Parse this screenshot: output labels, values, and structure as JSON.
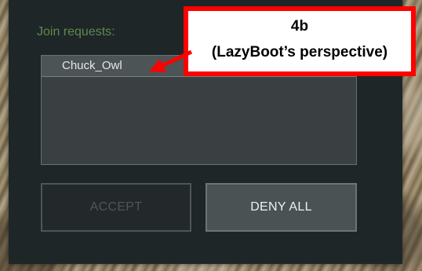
{
  "dialog": {
    "join_requests_label": "Join requests:",
    "requests": [
      {
        "name": "Chuck_Owl"
      }
    ],
    "accept_label": "ACCEPT",
    "deny_all_label": "DENY ALL"
  },
  "annotation": {
    "line1": "4b",
    "line2": "(LazyBoot’s perspective)"
  },
  "colors": {
    "panel": "#1f2628",
    "label_green": "#5f8a4a",
    "callout_border": "#ff0000"
  }
}
